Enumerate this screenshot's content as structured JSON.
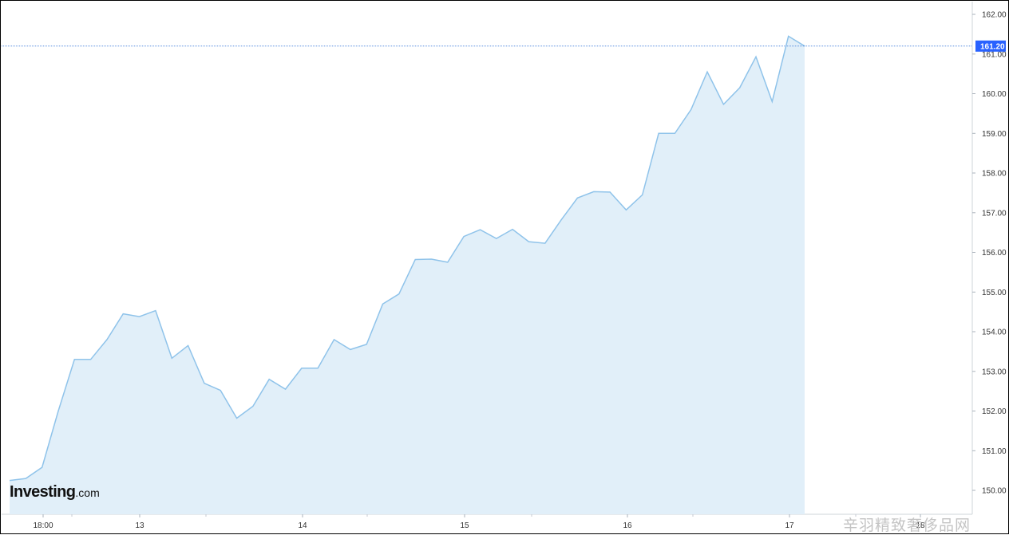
{
  "chart_data": {
    "type": "area",
    "title": "",
    "xlabel": "",
    "ylabel": "",
    "ylim": [
      149.6,
      162.3
    ],
    "y_ticks": [
      "150.00",
      "151.00",
      "152.00",
      "153.00",
      "154.00",
      "155.00",
      "156.00",
      "157.00",
      "158.00",
      "159.00",
      "160.00",
      "161.00",
      "162.00"
    ],
    "x_ticks": [
      "18:00",
      "13",
      "14",
      "15",
      "16",
      "17",
      "18"
    ],
    "last_value": "161.20",
    "grid": false,
    "colors": {
      "line": "#8fc3ea",
      "fill": "#e1eff9",
      "badge": "#2962ff",
      "crosshair": "#5b8fe0"
    },
    "series": [
      {
        "values": [
          150.25,
          150.3,
          150.58,
          152.0,
          153.3,
          153.3,
          153.8,
          154.45,
          154.38,
          154.53,
          153.33,
          153.65,
          152.7,
          152.52,
          151.82,
          152.12,
          152.8,
          152.55,
          153.08,
          153.08,
          153.8,
          153.55,
          153.68,
          154.7,
          154.95,
          155.82,
          155.83,
          155.75,
          156.4,
          156.57,
          156.35,
          156.58,
          156.27,
          156.23,
          156.82,
          157.37,
          157.53,
          157.52,
          157.07,
          157.45,
          159.0,
          159.0,
          159.6,
          160.55,
          159.73,
          160.15,
          160.93,
          159.8,
          161.45,
          161.2
        ]
      }
    ]
  },
  "branding": {
    "logo_brand": "Investing",
    "logo_tld": ".com"
  },
  "watermark": {
    "text": "辛羽精致奢侈品网"
  }
}
